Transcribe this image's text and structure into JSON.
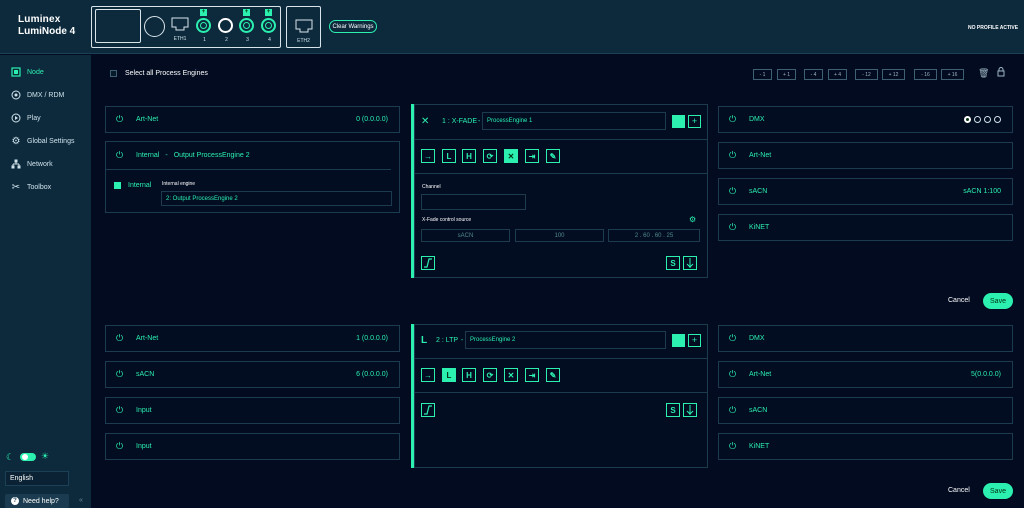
{
  "brand": {
    "line1": "Luminex",
    "line2": "LumiNode 4"
  },
  "ports": {
    "eth1": "ETH1",
    "eth2": "ETH2",
    "p1": "1",
    "p2": "2",
    "p3": "3",
    "p4": "4"
  },
  "header": {
    "clear_warnings": "Clear Warnings",
    "profile_status": "NO PROFILE ACTIVE"
  },
  "sidebar": {
    "items": [
      {
        "label": "Node",
        "icon": "node-icon"
      },
      {
        "label": "DMX / RDM",
        "icon": "dmx-icon"
      },
      {
        "label": "Play",
        "icon": "play-icon"
      },
      {
        "label": "Global Settings",
        "icon": "gear-icon"
      },
      {
        "label": "Network",
        "icon": "network-icon"
      },
      {
        "label": "Toolbox",
        "icon": "toolbox-icon"
      }
    ],
    "language": "English",
    "help": "Need help?",
    "collapse": "«"
  },
  "toolbar": {
    "select_all": "Select all Process Engines",
    "steps": [
      "- 1",
      "+ 1",
      "- 4",
      "+ 4",
      "- 12",
      "+ 12",
      "- 16",
      "+ 16"
    ]
  },
  "pe1": {
    "inputs": {
      "artnet_label": "Art-Net",
      "artnet_value": "0 (0.0.0.0)",
      "internal_label": "Internal",
      "internal_sep": "-",
      "internal_target": "Output ProcessEngine 2",
      "chk_label": "Internal",
      "engine_label": "Internal engine",
      "engine_value": "2: Output ProcessEngine 2"
    },
    "engine": {
      "mode": "1 : X-FADE",
      "sep": "-",
      "name": "ProcessEngine 1",
      "plus": "+",
      "channel_label": "Channel",
      "xfade_label": "X-Fade control source",
      "src": "sACN",
      "universe": "100",
      "address": "2 . 60 . 60 . 25",
      "s_btn": "S"
    },
    "outputs": {
      "dmx": "DMX",
      "artnet": "Art-Net",
      "sacn": "sACN",
      "sacn_value": "sACN 1:100",
      "kinet": "KiNET"
    },
    "cancel": "Cancel",
    "save": "Save"
  },
  "pe2": {
    "inputs": {
      "artnet_label": "Art-Net",
      "artnet_value": "1 (0.0.0.0)",
      "sacn_label": "sACN",
      "sacn_value": "6 (0.0.0.0)",
      "input1": "Input",
      "input2": "Input"
    },
    "engine": {
      "mode_letter": "L",
      "mode": "2 : LTP",
      "sep": "-",
      "name": "ProcessEngine 2",
      "plus": "+",
      "s_btn": "S"
    },
    "outputs": {
      "dmx": "DMX",
      "artnet": "Art-Net",
      "artnet_value": "5(0.0.0.0)",
      "sacn": "sACN",
      "kinet": "KiNET"
    },
    "cancel": "Cancel",
    "save": "Save"
  },
  "tools": [
    "→",
    "L",
    "H",
    "⟳",
    "✕",
    "⇥",
    "✎"
  ],
  "colors": {
    "accent": "#2bf0b0",
    "bg": "#020b20",
    "sidebar": "#0d2a3d"
  }
}
